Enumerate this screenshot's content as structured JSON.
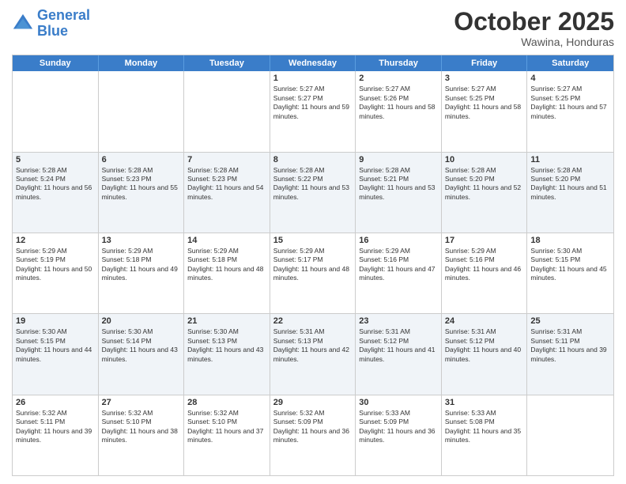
{
  "logo": {
    "line1": "General",
    "line2": "Blue"
  },
  "header": {
    "month": "October 2025",
    "location": "Wawina, Honduras"
  },
  "weekdays": [
    "Sunday",
    "Monday",
    "Tuesday",
    "Wednesday",
    "Thursday",
    "Friday",
    "Saturday"
  ],
  "rows": [
    [
      {
        "day": "",
        "text": ""
      },
      {
        "day": "",
        "text": ""
      },
      {
        "day": "",
        "text": ""
      },
      {
        "day": "1",
        "text": "Sunrise: 5:27 AM\nSunset: 5:27 PM\nDaylight: 11 hours and 59 minutes."
      },
      {
        "day": "2",
        "text": "Sunrise: 5:27 AM\nSunset: 5:26 PM\nDaylight: 11 hours and 58 minutes."
      },
      {
        "day": "3",
        "text": "Sunrise: 5:27 AM\nSunset: 5:25 PM\nDaylight: 11 hours and 58 minutes."
      },
      {
        "day": "4",
        "text": "Sunrise: 5:27 AM\nSunset: 5:25 PM\nDaylight: 11 hours and 57 minutes."
      }
    ],
    [
      {
        "day": "5",
        "text": "Sunrise: 5:28 AM\nSunset: 5:24 PM\nDaylight: 11 hours and 56 minutes."
      },
      {
        "day": "6",
        "text": "Sunrise: 5:28 AM\nSunset: 5:23 PM\nDaylight: 11 hours and 55 minutes."
      },
      {
        "day": "7",
        "text": "Sunrise: 5:28 AM\nSunset: 5:23 PM\nDaylight: 11 hours and 54 minutes."
      },
      {
        "day": "8",
        "text": "Sunrise: 5:28 AM\nSunset: 5:22 PM\nDaylight: 11 hours and 53 minutes."
      },
      {
        "day": "9",
        "text": "Sunrise: 5:28 AM\nSunset: 5:21 PM\nDaylight: 11 hours and 53 minutes."
      },
      {
        "day": "10",
        "text": "Sunrise: 5:28 AM\nSunset: 5:20 PM\nDaylight: 11 hours and 52 minutes."
      },
      {
        "day": "11",
        "text": "Sunrise: 5:28 AM\nSunset: 5:20 PM\nDaylight: 11 hours and 51 minutes."
      }
    ],
    [
      {
        "day": "12",
        "text": "Sunrise: 5:29 AM\nSunset: 5:19 PM\nDaylight: 11 hours and 50 minutes."
      },
      {
        "day": "13",
        "text": "Sunrise: 5:29 AM\nSunset: 5:18 PM\nDaylight: 11 hours and 49 minutes."
      },
      {
        "day": "14",
        "text": "Sunrise: 5:29 AM\nSunset: 5:18 PM\nDaylight: 11 hours and 48 minutes."
      },
      {
        "day": "15",
        "text": "Sunrise: 5:29 AM\nSunset: 5:17 PM\nDaylight: 11 hours and 48 minutes."
      },
      {
        "day": "16",
        "text": "Sunrise: 5:29 AM\nSunset: 5:16 PM\nDaylight: 11 hours and 47 minutes."
      },
      {
        "day": "17",
        "text": "Sunrise: 5:29 AM\nSunset: 5:16 PM\nDaylight: 11 hours and 46 minutes."
      },
      {
        "day": "18",
        "text": "Sunrise: 5:30 AM\nSunset: 5:15 PM\nDaylight: 11 hours and 45 minutes."
      }
    ],
    [
      {
        "day": "19",
        "text": "Sunrise: 5:30 AM\nSunset: 5:15 PM\nDaylight: 11 hours and 44 minutes."
      },
      {
        "day": "20",
        "text": "Sunrise: 5:30 AM\nSunset: 5:14 PM\nDaylight: 11 hours and 43 minutes."
      },
      {
        "day": "21",
        "text": "Sunrise: 5:30 AM\nSunset: 5:13 PM\nDaylight: 11 hours and 43 minutes."
      },
      {
        "day": "22",
        "text": "Sunrise: 5:31 AM\nSunset: 5:13 PM\nDaylight: 11 hours and 42 minutes."
      },
      {
        "day": "23",
        "text": "Sunrise: 5:31 AM\nSunset: 5:12 PM\nDaylight: 11 hours and 41 minutes."
      },
      {
        "day": "24",
        "text": "Sunrise: 5:31 AM\nSunset: 5:12 PM\nDaylight: 11 hours and 40 minutes."
      },
      {
        "day": "25",
        "text": "Sunrise: 5:31 AM\nSunset: 5:11 PM\nDaylight: 11 hours and 39 minutes."
      }
    ],
    [
      {
        "day": "26",
        "text": "Sunrise: 5:32 AM\nSunset: 5:11 PM\nDaylight: 11 hours and 39 minutes."
      },
      {
        "day": "27",
        "text": "Sunrise: 5:32 AM\nSunset: 5:10 PM\nDaylight: 11 hours and 38 minutes."
      },
      {
        "day": "28",
        "text": "Sunrise: 5:32 AM\nSunset: 5:10 PM\nDaylight: 11 hours and 37 minutes."
      },
      {
        "day": "29",
        "text": "Sunrise: 5:32 AM\nSunset: 5:09 PM\nDaylight: 11 hours and 36 minutes."
      },
      {
        "day": "30",
        "text": "Sunrise: 5:33 AM\nSunset: 5:09 PM\nDaylight: 11 hours and 36 minutes."
      },
      {
        "day": "31",
        "text": "Sunrise: 5:33 AM\nSunset: 5:08 PM\nDaylight: 11 hours and 35 minutes."
      },
      {
        "day": "",
        "text": ""
      }
    ]
  ]
}
